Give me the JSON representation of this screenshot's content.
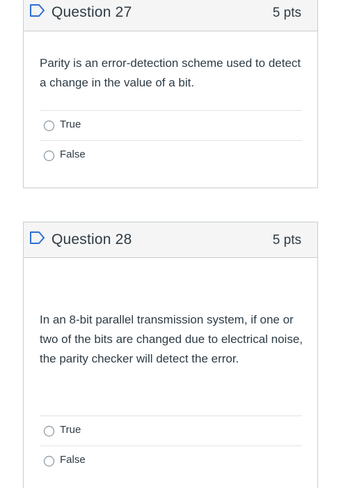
{
  "questions": [
    {
      "title": "Question 27",
      "points": "5 pts",
      "text": "Parity is an error-detection scheme used to detect a change in the value of a bit.",
      "answers": [
        "True",
        "False"
      ],
      "flag_icon": "flag-outline-icon"
    },
    {
      "title": "Question 28",
      "points": "5 pts",
      "text": "In an 8-bit parallel transmission system, if one or two of the bits are changed due to electrical noise, the parity checker will detect the error.",
      "answers": [
        "True",
        "False"
      ],
      "flag_icon": "flag-outline-icon"
    }
  ],
  "colors": {
    "flag": "#2d6fd6",
    "header_bg": "#f5f5f5",
    "border": "#c7cdd1",
    "text": "#2d3b45"
  }
}
